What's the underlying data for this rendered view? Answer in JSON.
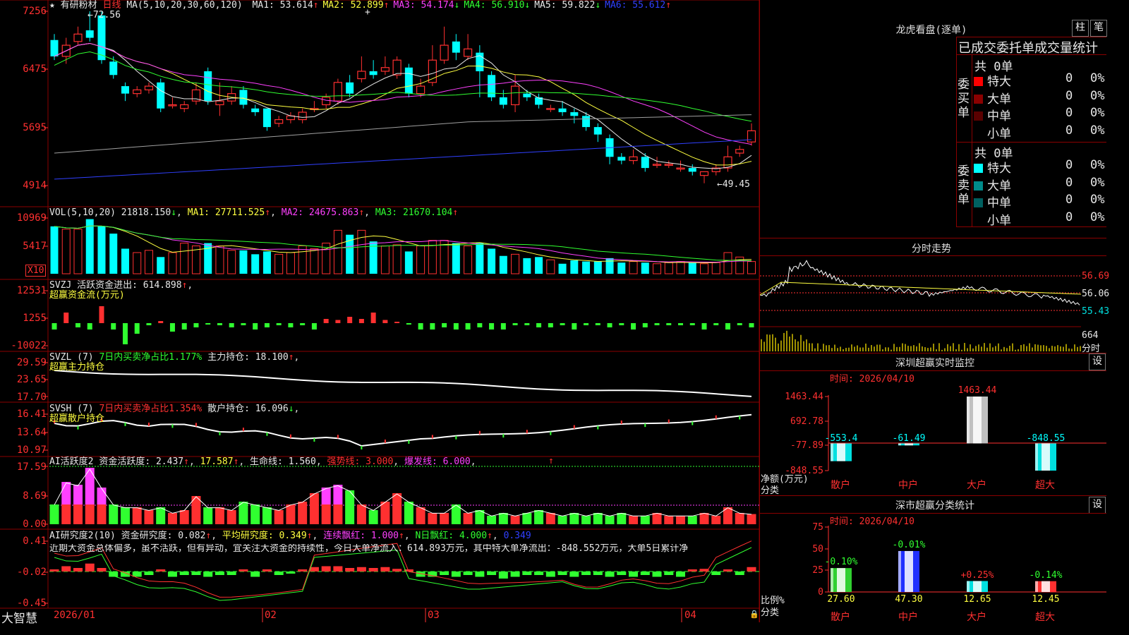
{
  "main": {
    "star": "★",
    "name": "有研粉材",
    "period": "日线",
    "ma_title": "MA(5,10,20,30,60,120)",
    "ma": [
      {
        "label": "MA1:",
        "value": "53.614",
        "arrow": "↑",
        "color": "#e8e8e8"
      },
      {
        "label": "MA2:",
        "value": "52.899",
        "arrow": "↑",
        "color": "#ffff40"
      },
      {
        "label": "MA3:",
        "value": "54.174",
        "arrow": "↓",
        "color": "#ff40ff"
      },
      {
        "label": "MA4:",
        "value": "56.910",
        "arrow": "↓",
        "color": "#30ff30"
      },
      {
        "label": "MA5:",
        "value": "59.822",
        "arrow": "↓",
        "color": "#e8e8e8"
      },
      {
        "label": "MA6:",
        "value": "55.612",
        "arrow": "↑",
        "color": "#3040ff"
      }
    ],
    "y_ticks": [
      "7256",
      "6475",
      "5695",
      "4914"
    ],
    "high_mark": "72.56",
    "low_mark": "49.45",
    "x_labels": [
      "2026/01",
      "02",
      "03",
      "04"
    ]
  },
  "vol": {
    "title": "VOL(5,10,20)",
    "value": "21818.150",
    "value_arrow": "↓",
    "ma1": "MA1: 27711.525",
    "ma2": "MA2: 24675.863",
    "ma3": "MA3: 21670.104",
    "up": "↑",
    "y_ticks": [
      "10969",
      "5417"
    ],
    "unit": "X10"
  },
  "svzj": {
    "title": "SVZJ",
    "label": "活跃资金进出: 614.898",
    "arrow": "↑",
    "subtitle": "超赢资金流(万元)",
    "y_ticks": [
      "12531",
      "1255",
      "-10022"
    ]
  },
  "svzl": {
    "title": "SVZL (7)",
    "label": "7日内买卖净占比1.177%",
    "hold": "主力持仓: 18.100",
    "arrow": "↑",
    "subtitle": "超赢主力持仓",
    "y_ticks": [
      "29.59",
      "23.65",
      "17.70"
    ]
  },
  "svsh": {
    "title": "SVSH (7)",
    "label": "7日内买卖净占比1.354%",
    "hold": "散户持仓: 16.096",
    "arrow": "↓",
    "subtitle": "超赢散户持仓",
    "y_ticks": [
      "16.41",
      "13.64",
      "10.97"
    ]
  },
  "ai_active": {
    "title": "AI活跃度2",
    "a": "资金活跃度: 2.437",
    "b": "17.587",
    "c": "生命线: 1.560",
    "d": "强势线: 3.000",
    "e": "爆发线: 6.000",
    "y_ticks": [
      "17.59",
      "8.69",
      "0.00"
    ]
  },
  "ai_research": {
    "title": "AI研究度2(10)",
    "a": "资金研究度: 0.082",
    "b": "平均研究度: 0.349",
    "c": "连续飘红: 1.000",
    "d": "N日飘红: 4.000",
    "e": "0.349",
    "text": "近期大资金总体偏多，虽不活跃，但有异动，宜关注大资金的持续性，今日大单净流入：614.893万元，其中特大单净流出：-848.552万元，大单5日累计净",
    "y_ticks": [
      "0.41",
      "-0.02",
      "-0.45"
    ]
  },
  "footer": {
    "brand": "大智慧"
  },
  "lhb": {
    "title": "龙虎看盘(逐单)",
    "tab_zhu": "柱",
    "tab_bi": "笔",
    "header": "已成交委托单成交量统计",
    "buy_label": "委买单",
    "sell_label": "委卖单",
    "buy_total": "共 0单",
    "sell_total": "共 0单",
    "rows": [
      "特大",
      "大单",
      "中单",
      "小单"
    ],
    "counts": [
      "0",
      "0",
      "0",
      "0"
    ],
    "pcts": [
      "0%",
      "0%",
      "0%",
      "0%"
    ],
    "buy_colors": [
      "#ff0000",
      "#8b0000",
      "#5a0000",
      "#000000"
    ],
    "sell_colors": [
      "#00ffff",
      "#008b8b",
      "#006060",
      "#000000"
    ]
  },
  "fenshi": {
    "title": "分时走势",
    "y_ticks": [
      "56.69",
      "56.06",
      "55.43"
    ],
    "vol_tick": "664",
    "unit": "分时"
  },
  "monitor": {
    "title": "深圳超赢实时监控",
    "btn": "设",
    "time": "时间: 2026/04/10",
    "y_ticks": [
      "1463.44",
      "692.78",
      "-77.89",
      "-848.55"
    ],
    "axis_label": "净额(万元)",
    "cat_label": "分类",
    "chart_data": {
      "type": "bar",
      "categories": [
        "散户",
        "中户",
        "大户",
        "超大"
      ],
      "values": [
        -553.4,
        -61.49,
        1463.44,
        -848.55
      ],
      "value_labels": [
        "-553.4",
        "-61.49",
        "1463.44",
        "-848.55"
      ],
      "ylim": [
        -848.55,
        1463.44
      ]
    }
  },
  "classify": {
    "title": "深市超赢分类统计",
    "btn": "设",
    "time": "时间: 2026/04/10",
    "y_ticks": [
      "75",
      "50",
      "25",
      "0"
    ],
    "axis_label": "比例%",
    "cat_label": "分类",
    "chart_data": {
      "type": "bar",
      "categories": [
        "散户",
        "中户",
        "大户",
        "超大"
      ],
      "values": [
        27.6,
        47.3,
        12.65,
        12.45
      ],
      "value_labels": [
        "27.60",
        "47.30",
        "12.65",
        "12.45"
      ],
      "changes": [
        "-0.10%",
        "-0.01%",
        "+0.25%",
        "-0.14%"
      ],
      "ylim": [
        0,
        75
      ]
    }
  },
  "colors": {
    "up": "#ff3030",
    "down": "#00ffff",
    "border": "#8b0000",
    "ma_white": "#e8e8e8",
    "ma_yellow": "#ffff40",
    "ma_magenta": "#ff40ff",
    "ma_green": "#30ff30",
    "ma_blue": "#3040ff",
    "ma_gray": "#a0a0a0"
  },
  "chart_data": {
    "type": "candlestick",
    "title": "有研粉材 日线",
    "unit_note": "price axis ticks shown as 7256/6475/5695/4914",
    "ylim": [
      4914,
      7256
    ],
    "candles": [
      [
        6870,
        6650,
        6950,
        6600
      ],
      [
        6650,
        6800,
        6900,
        6550
      ],
      [
        6850,
        6950,
        7050,
        6800
      ],
      [
        7000,
        6900,
        7256,
        6850
      ],
      [
        7200,
        6600,
        7250,
        6550
      ],
      [
        6580,
        6400,
        6650,
        6350
      ],
      [
        6250,
        6150,
        6300,
        6050
      ],
      [
        6150,
        6200,
        6250,
        6100
      ],
      [
        6200,
        6250,
        6300,
        6150
      ],
      [
        6300,
        5950,
        6350,
        5900
      ],
      [
        6000,
        6000,
        6100,
        5950
      ],
      [
        5950,
        6000,
        6050,
        5900
      ],
      [
        6050,
        6200,
        6300,
        6000
      ],
      [
        6450,
        6050,
        6500,
        6000
      ],
      [
        6000,
        6050,
        6300,
        5850
      ],
      [
        6050,
        6150,
        6250,
        6000
      ],
      [
        6200,
        6000,
        6250,
        5950
      ],
      [
        5950,
        5900,
        6000,
        5850
      ],
      [
        5950,
        5700,
        5950,
        5650
      ],
      [
        5750,
        5800,
        5850,
        5700
      ],
      [
        5800,
        5850,
        5900,
        5750
      ],
      [
        5800,
        5900,
        5950,
        5750
      ],
      [
        5950,
        5950,
        6050,
        5900
      ],
      [
        6000,
        6100,
        6150,
        5950
      ],
      [
        6050,
        6300,
        6350,
        6000
      ],
      [
        6300,
        6150,
        6400,
        6100
      ],
      [
        6350,
        6450,
        6650,
        6300
      ],
      [
        6450,
        6400,
        6600,
        6350
      ],
      [
        6450,
        6500,
        6650,
        6400
      ],
      [
        6400,
        6600,
        6650,
        6350
      ],
      [
        6500,
        6150,
        6550,
        6100
      ],
      [
        6150,
        6250,
        6350,
        6100
      ],
      [
        6300,
        6600,
        6800,
        6250
      ],
      [
        6600,
        6800,
        7050,
        6550
      ],
      [
        6850,
        6700,
        6950,
        6600
      ],
      [
        6650,
        6750,
        6950,
        6600
      ],
      [
        6700,
        6450,
        6800,
        6100
      ],
      [
        6400,
        6100,
        6450,
        6050
      ],
      [
        6100,
        6000,
        6200,
        5950
      ],
      [
        6000,
        6250,
        6400,
        5900
      ],
      [
        6150,
        6100,
        6200,
        6050
      ],
      [
        6100,
        6000,
        6150,
        5950
      ],
      [
        5950,
        5950,
        6000,
        5900
      ],
      [
        5950,
        5900,
        6050,
        5850
      ],
      [
        5900,
        5850,
        5950,
        5750
      ],
      [
        5850,
        5700,
        5900,
        5650
      ],
      [
        5700,
        5600,
        5750,
        5500
      ],
      [
        5550,
        5300,
        5600,
        5200
      ],
      [
        5300,
        5250,
        5350,
        5200
      ],
      [
        5250,
        5300,
        5400,
        5200
      ],
      [
        5300,
        5150,
        5350,
        5100
      ],
      [
        5200,
        5200,
        5300,
        5150
      ],
      [
        5200,
        5200,
        5250,
        5150
      ],
      [
        5150,
        5150,
        5250,
        5100
      ],
      [
        5150,
        5100,
        5200,
        5050
      ],
      [
        5050,
        5100,
        5100,
        4945
      ],
      [
        5100,
        5150,
        5200,
        5050
      ],
      [
        5150,
        5300,
        5450,
        5100
      ],
      [
        5350,
        5400,
        5450,
        5300
      ],
      [
        5500,
        5650,
        5750,
        5450
      ]
    ]
  }
}
